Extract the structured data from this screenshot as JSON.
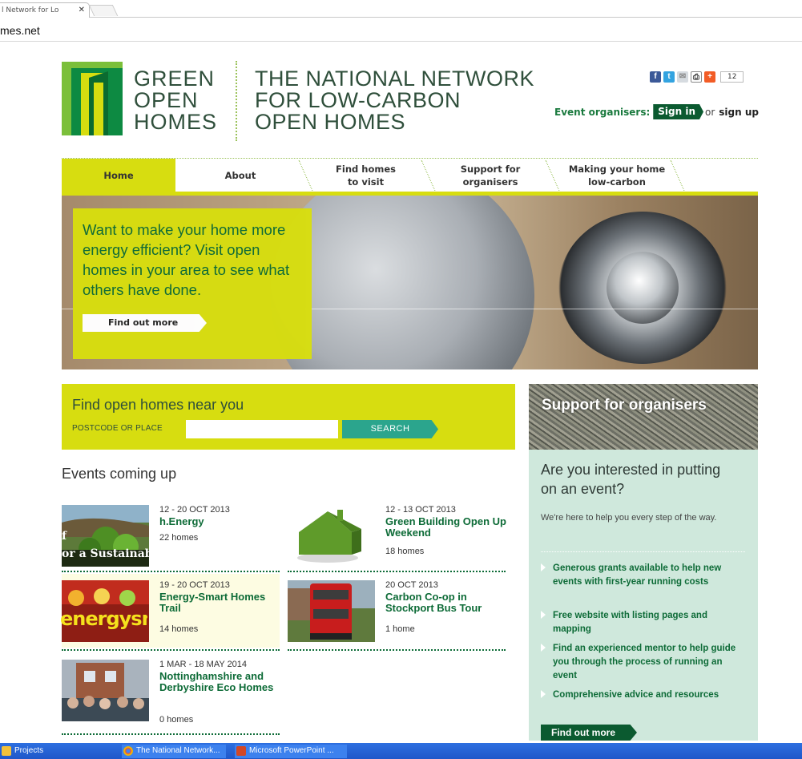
{
  "browser": {
    "tab_title": "l Network for Lo",
    "tab_close": "✕",
    "url": "mes.net"
  },
  "brand": {
    "name_lines": [
      "GREEN",
      "OPEN",
      "HOMES"
    ],
    "tagline_lines": [
      "THE NATIONAL NETWORK",
      "FOR LOW-CARBON",
      "OPEN HOMES"
    ],
    "colors": {
      "green": "#0d6b37",
      "lime": "#d7dd10",
      "teal": "#2ba58d",
      "mint": "#cfe8dc"
    }
  },
  "social": {
    "icons": [
      "facebook-icon",
      "twitter-icon",
      "email-icon",
      "print-icon",
      "addthis-icon"
    ],
    "count": "12"
  },
  "auth": {
    "label": "Event organisers:",
    "signin": "Sign in",
    "or": "or",
    "signup": "sign up"
  },
  "nav": [
    {
      "label": "Home"
    },
    {
      "label": "About"
    },
    {
      "label": "Find homes\nto visit"
    },
    {
      "label": "Support for\norganisers"
    },
    {
      "label": "Making your home\nlow-carbon"
    }
  ],
  "hero": {
    "text": "Want to make your home more energy efficient? Visit open homes in your area to see what others have done.",
    "cta": "Find out more"
  },
  "search": {
    "title": "Find open homes near you",
    "label": "POSTCODE OR PLACE",
    "value": "",
    "button": "SEARCH"
  },
  "events": {
    "title": "Events coming up",
    "items": [
      {
        "date": "12 - 20 OCT 2013",
        "title": "h.Energy",
        "homes": "22 homes",
        "thumb_text": "f\nor a Sustainab"
      },
      {
        "date": "12 - 13 OCT 2013",
        "title": "Green Building Open Up Weekend",
        "homes": "18 homes"
      },
      {
        "date": "19 - 20 OCT 2013",
        "title": "Energy-Smart Homes Trail",
        "homes": "14 homes",
        "thumb_text": "energysma"
      },
      {
        "date": "20 OCT 2013",
        "title": "Carbon Co-op in Stockport Bus Tour",
        "homes": "1 home"
      },
      {
        "date": "1 MAR - 18 MAY 2014",
        "title": "Nottinghamshire and Derbyshire Eco Homes",
        "homes": "0 homes"
      }
    ]
  },
  "sidebar": {
    "banner": "Support for organisers",
    "question": "Are you interested in putting on an event?",
    "intro": "We're here to help you every step of the way.",
    "benefits": [
      "Generous grants available to help new events with first-year running costs",
      "Free website with listing pages and mapping",
      "Find an experienced mentor to help guide you through the process of running an event",
      "Comprehensive advice and resources"
    ],
    "cta": "Find out more"
  },
  "taskbar": {
    "items": [
      "Projects",
      "The National Network...",
      "Microsoft PowerPoint ..."
    ]
  }
}
